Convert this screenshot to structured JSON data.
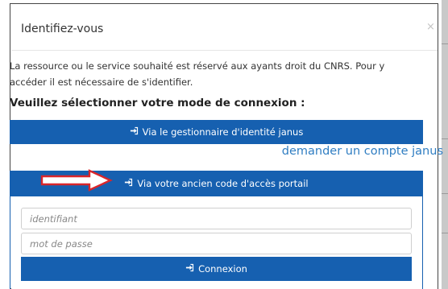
{
  "modal": {
    "title": "Identifiez-vous",
    "close_label": "×",
    "intro_line1": "La ressource ou le service souhaité est réservé aux ayants droit du CNRS. Pour y",
    "intro_line2": "accéder il est nécessaire de s'identifier.",
    "prompt": "Veuillez sélectionner votre mode de connexion :"
  },
  "options": {
    "janus_button": "Via le gestionnaire d'identité janus",
    "janus_request_link": "demander un compte janus",
    "portal_button": "Via votre ancien code d'accès portail"
  },
  "form": {
    "identifiant_placeholder": "identifiant",
    "password_placeholder": "mot de passe",
    "submit_label": "Connexion"
  },
  "colors": {
    "primary": "#1660b0",
    "link": "#2f7dc2",
    "annotation_arrow": "#d9262b"
  },
  "icons": {
    "login_icon": "sign-in-icon"
  }
}
